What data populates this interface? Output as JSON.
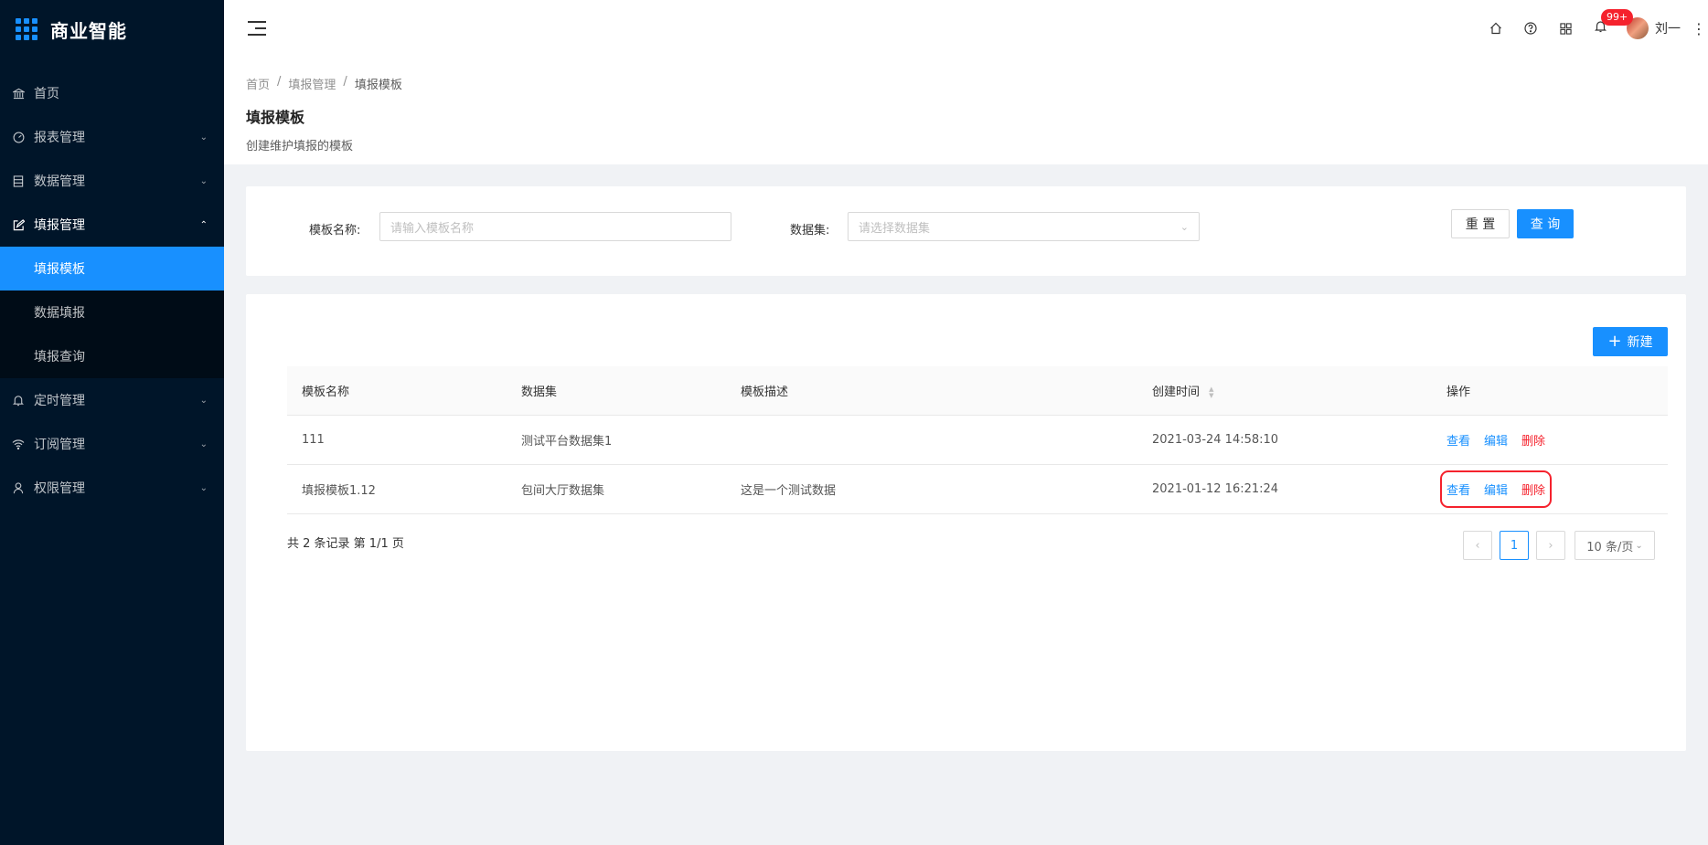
{
  "app": {
    "title": "商业智能",
    "accent": "#1890ff",
    "sidebar_bg": "#001529"
  },
  "sidebar": {
    "items": [
      {
        "label": "首页",
        "icon": "bank-icon"
      },
      {
        "label": "报表管理",
        "icon": "dashboard-icon"
      },
      {
        "label": "数据管理",
        "icon": "database-icon"
      },
      {
        "label": "填报管理",
        "icon": "edit-icon"
      },
      {
        "label": "定时管理",
        "icon": "bell-icon"
      },
      {
        "label": "订阅管理",
        "icon": "wifi-icon"
      },
      {
        "label": "权限管理",
        "icon": "user-icon"
      }
    ],
    "submenu": [
      {
        "label": "填报模板"
      },
      {
        "label": "数据填报"
      },
      {
        "label": "填报查询"
      }
    ]
  },
  "header": {
    "badge": "99+",
    "user_name": "刘一"
  },
  "breadcrumb": [
    "首页",
    "/",
    "填报管理",
    "/",
    "填报模板"
  ],
  "page": {
    "title": "填报模板",
    "description": "创建维护填报的模板"
  },
  "filter": {
    "name_label": "模板名称:",
    "name_placeholder": "请输入模板名称",
    "dataset_label": "数据集:",
    "dataset_placeholder": "请选择数据集",
    "reset": "重 置",
    "query": "查 询"
  },
  "table": {
    "new_button": "新建",
    "columns": [
      "模板名称",
      "数据集",
      "模板描述",
      "创建时间",
      "操作"
    ],
    "rows": [
      {
        "name": "111",
        "dataset": "测试平台数据集1",
        "desc": "",
        "created": "2021-03-24 14:58:10"
      },
      {
        "name": "填报模板1.12",
        "dataset": "包间大厅数据集",
        "desc": "这是一个测试数据",
        "created": "2021-01-12 16:21:24"
      }
    ],
    "actions": {
      "view": "查看",
      "edit": "编辑",
      "delete": "删除"
    }
  },
  "pagination": {
    "summary": "共 2 条记录 第 1/1 页",
    "current": "1",
    "page_size": "10 条/页"
  }
}
